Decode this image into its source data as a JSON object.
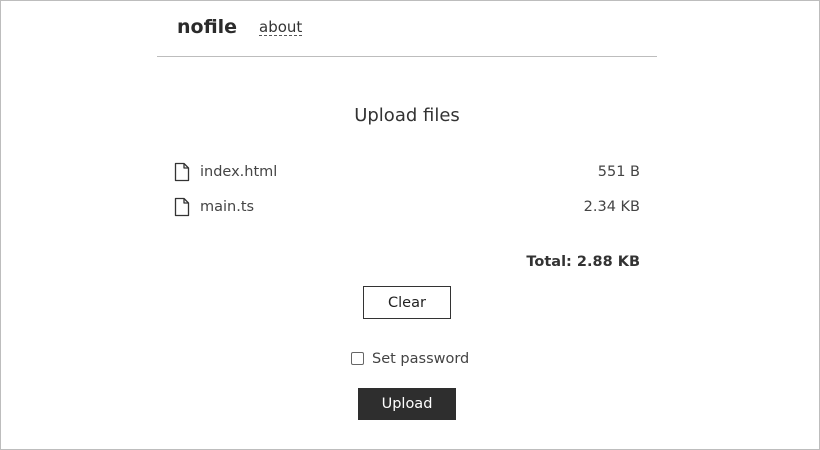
{
  "header": {
    "brand": "nofile",
    "about_link": "about"
  },
  "main": {
    "title": "Upload files",
    "files": [
      {
        "name": "index.html",
        "size": "551 B",
        "icon": "file-icon"
      },
      {
        "name": "main.ts",
        "size": "2.34 KB",
        "icon": "file-icon"
      }
    ],
    "total": "Total: 2.88 KB",
    "clear_label": "Clear",
    "password_label": "Set password",
    "password_checked": false,
    "upload_label": "Upload"
  },
  "colors": {
    "text": "#333333",
    "border": "#bdbdbd",
    "upload_button_bg": "#2e2e2e",
    "upload_button_text": "#ffffff"
  }
}
